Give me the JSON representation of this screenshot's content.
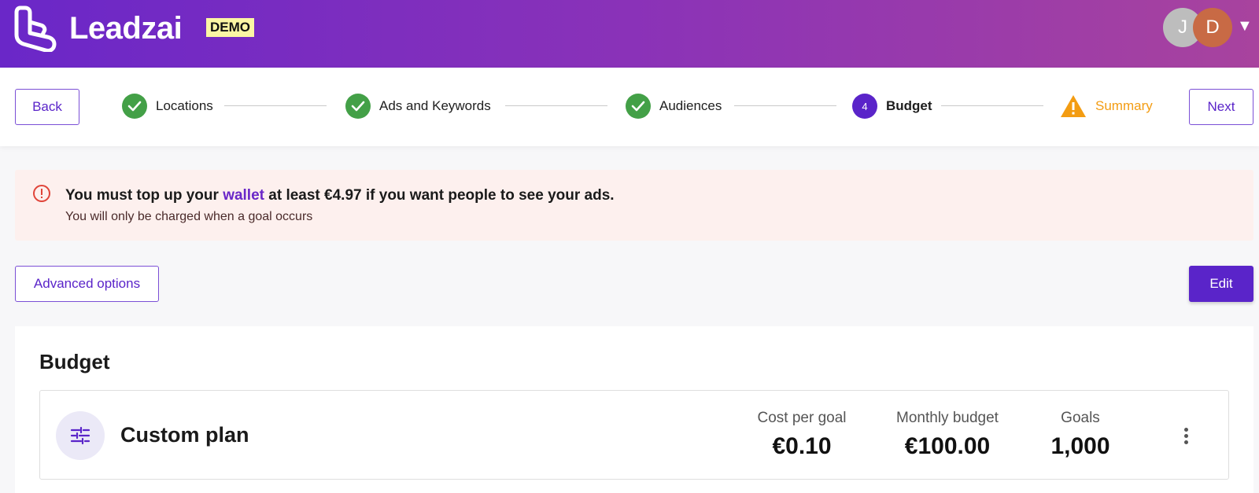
{
  "header": {
    "brand": "Leadzai",
    "badge": "DEMO",
    "avatars": [
      "J",
      "D"
    ],
    "user_menu_caret": "▼"
  },
  "nav": {
    "back_label": "Back",
    "next_label": "Next"
  },
  "steps": [
    {
      "label": "Locations",
      "status": "done"
    },
    {
      "label": "Ads and Keywords",
      "status": "done"
    },
    {
      "label": "Audiences",
      "status": "done"
    },
    {
      "label": "Budget",
      "status": "active",
      "number": "4"
    },
    {
      "label": "Summary",
      "status": "warning"
    }
  ],
  "alert": {
    "text_before": "You must top up your ",
    "link": "wallet",
    "text_after": " at least €4.97 if you want people to see your ads.",
    "subtext": "You will only be charged when a goal occurs"
  },
  "actions": {
    "advanced_label": "Advanced options",
    "edit_label": "Edit"
  },
  "budget": {
    "title": "Budget",
    "plan_name": "Custom plan",
    "stats": [
      {
        "label": "Cost per goal",
        "value": "€0.10"
      },
      {
        "label": "Monthly budget",
        "value": "€100.00"
      },
      {
        "label": "Goals",
        "value": "1,000"
      }
    ]
  },
  "colors": {
    "accent": "#5a24c9",
    "success": "#43a047",
    "warning": "#f39c12",
    "alert_bg": "#fdf0ee"
  }
}
